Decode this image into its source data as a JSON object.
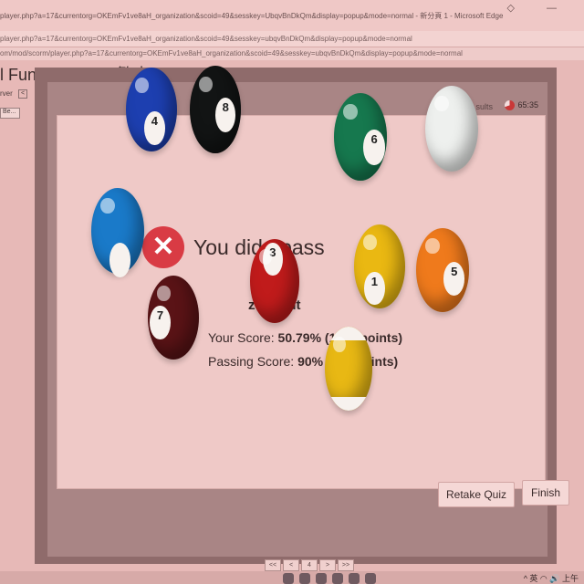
{
  "browser": {
    "title": "player.php?a=17&currentorg=OKEmFv1ve8aH_organization&scoid=49&sesskey=UbqvBnDkQm&display=popup&mode=normal - 新分頁 1 - Microsoft Edge",
    "url": "player.php?a=17&currentorg=OKEmFv1ve8aH_organization&scoid=49&sesskey=ubqvBnDkQm&display=popup&mode=normal",
    "url2": "om/mod/scorm/player.php?a=17&currentorg=OKEmFv1ve8aH_organization&scoid=49&sesskey=ubqvBnDkQm&display=popup&mode=normal",
    "window_controls": "◇ —"
  },
  "course": {
    "title": "l Fundamentals 繁中(",
    "side_label": "rver",
    "side_btn": "<",
    "side_select": "Be..."
  },
  "quiz": {
    "results_tab": "sults",
    "timer": "65:35",
    "fail_icon": "✕",
    "fail_message": "You did t pass",
    "result_title": "z Result",
    "score_label": "Your Score: ",
    "score_value": "50.79% (1",
    "score_suffix": "points)",
    "passing_label": "Passing Score: ",
    "passing_value": "90%",
    "passing_suffix": "oints)",
    "retake_label": "Retake Quiz",
    "finish_label": "Finish"
  },
  "pager": [
    "<<",
    "<",
    "4",
    ">",
    ">>"
  ],
  "taskbar": {
    "tray_text": "^ 英 ◠ 🔊 上午"
  },
  "balls": {
    "ball4": "4",
    "ball8": "8",
    "ball6": "6",
    "ball3": "3",
    "ball1": "1",
    "ball5": "5",
    "ball7": "7"
  }
}
